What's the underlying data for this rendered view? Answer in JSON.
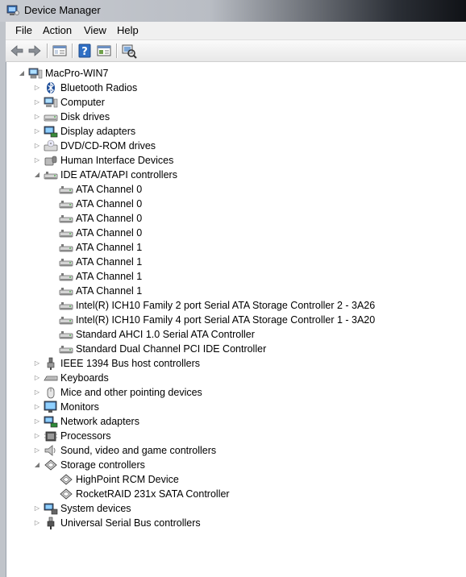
{
  "window": {
    "title": "Device Manager"
  },
  "menu": [
    "File",
    "Action",
    "View",
    "Help"
  ],
  "toolbar": {
    "buttons": [
      "back-arrow-icon",
      "forward-arrow-icon",
      "show-hide-tree-icon",
      "help-icon",
      "properties-icon",
      "scan-hardware-icon"
    ]
  },
  "tree": {
    "root": {
      "label": "MacPro-WIN7",
      "icon": "computer-icon",
      "expanded": true
    },
    "rows": [
      {
        "label": "Bluetooth Radios",
        "icon": "bluetooth-icon",
        "level": 1,
        "expander": "collapsed"
      },
      {
        "label": "Computer",
        "icon": "computer-icon",
        "level": 1,
        "expander": "collapsed"
      },
      {
        "label": "Disk drives",
        "icon": "disk-drive-icon",
        "level": 1,
        "expander": "collapsed"
      },
      {
        "label": "Display adapters",
        "icon": "display-adapter-icon",
        "level": 1,
        "expander": "collapsed"
      },
      {
        "label": "DVD/CD-ROM drives",
        "icon": "dvd-drive-icon",
        "level": 1,
        "expander": "collapsed"
      },
      {
        "label": "Human Interface Devices",
        "icon": "hid-icon",
        "level": 1,
        "expander": "collapsed"
      },
      {
        "label": "IDE ATA/ATAPI controllers",
        "icon": "ide-controller-icon",
        "level": 1,
        "expander": "expanded"
      },
      {
        "label": "ATA Channel 0",
        "icon": "ide-controller-icon",
        "level": 2,
        "expander": "none"
      },
      {
        "label": "ATA Channel 0",
        "icon": "ide-controller-icon",
        "level": 2,
        "expander": "none"
      },
      {
        "label": "ATA Channel 0",
        "icon": "ide-controller-icon",
        "level": 2,
        "expander": "none"
      },
      {
        "label": "ATA Channel 0",
        "icon": "ide-controller-icon",
        "level": 2,
        "expander": "none"
      },
      {
        "label": "ATA Channel 1",
        "icon": "ide-controller-icon",
        "level": 2,
        "expander": "none"
      },
      {
        "label": "ATA Channel 1",
        "icon": "ide-controller-icon",
        "level": 2,
        "expander": "none"
      },
      {
        "label": "ATA Channel 1",
        "icon": "ide-controller-icon",
        "level": 2,
        "expander": "none"
      },
      {
        "label": "ATA Channel 1",
        "icon": "ide-controller-icon",
        "level": 2,
        "expander": "none"
      },
      {
        "label": "Intel(R) ICH10 Family 2 port Serial ATA Storage Controller 2 - 3A26",
        "icon": "ide-controller-icon",
        "level": 2,
        "expander": "none"
      },
      {
        "label": "Intel(R) ICH10 Family 4 port Serial ATA Storage Controller 1 - 3A20",
        "icon": "ide-controller-icon",
        "level": 2,
        "expander": "none"
      },
      {
        "label": "Standard AHCI 1.0 Serial ATA Controller",
        "icon": "ide-controller-icon",
        "level": 2,
        "expander": "none"
      },
      {
        "label": "Standard Dual Channel PCI IDE Controller",
        "icon": "ide-controller-icon",
        "level": 2,
        "expander": "none"
      },
      {
        "label": "IEEE 1394 Bus host controllers",
        "icon": "firewire-icon",
        "level": 1,
        "expander": "collapsed"
      },
      {
        "label": "Keyboards",
        "icon": "keyboard-icon",
        "level": 1,
        "expander": "collapsed"
      },
      {
        "label": "Mice and other pointing devices",
        "icon": "mouse-icon",
        "level": 1,
        "expander": "collapsed"
      },
      {
        "label": "Monitors",
        "icon": "monitor-icon",
        "level": 1,
        "expander": "collapsed"
      },
      {
        "label": "Network adapters",
        "icon": "network-adapter-icon",
        "level": 1,
        "expander": "collapsed"
      },
      {
        "label": "Processors",
        "icon": "processor-icon",
        "level": 1,
        "expander": "collapsed"
      },
      {
        "label": "Sound, video and game controllers",
        "icon": "speaker-icon",
        "level": 1,
        "expander": "collapsed"
      },
      {
        "label": "Storage controllers",
        "icon": "storage-controller-icon",
        "level": 1,
        "expander": "expanded"
      },
      {
        "label": "HighPoint RCM Device",
        "icon": "storage-controller-icon",
        "level": 2,
        "expander": "none"
      },
      {
        "label": "RocketRAID 231x SATA Controller",
        "icon": "storage-controller-icon",
        "level": 2,
        "expander": "none"
      },
      {
        "label": "System devices",
        "icon": "system-devices-icon",
        "level": 1,
        "expander": "collapsed"
      },
      {
        "label": "Universal Serial Bus controllers",
        "icon": "usb-icon",
        "level": 1,
        "expander": "collapsed"
      }
    ]
  },
  "colors": {
    "accent": "#2f6fc4",
    "expander": "#7a7a7a",
    "text": "#000000"
  }
}
